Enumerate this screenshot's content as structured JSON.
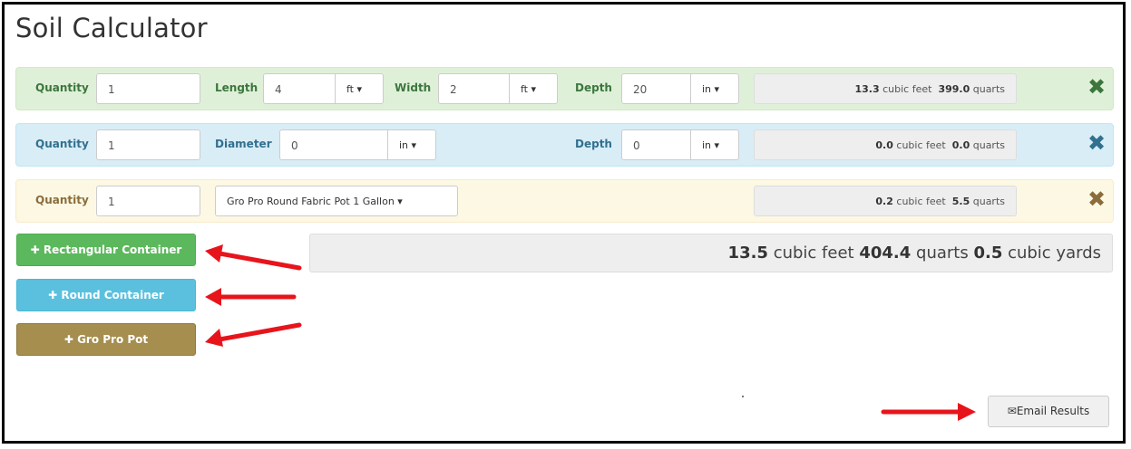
{
  "title": "Soil Calculator",
  "rows": {
    "rect": {
      "quantity_label": "Quantity",
      "quantity_value": "1",
      "length_label": "Length",
      "length_value": "4",
      "length_unit": "ft",
      "width_label": "Width",
      "width_value": "2",
      "width_unit": "ft",
      "depth_label": "Depth",
      "depth_value": "20",
      "depth_unit": "in",
      "result_cubic_feet": "13.3",
      "result_cubic_feet_unit": "cubic feet",
      "result_quarts": "399.0",
      "result_quarts_unit": "quarts"
    },
    "round": {
      "quantity_label": "Quantity",
      "quantity_value": "1",
      "diameter_label": "Diameter",
      "diameter_value": "0",
      "diameter_unit": "in",
      "depth_label": "Depth",
      "depth_value": "0",
      "depth_unit": "in",
      "result_cubic_feet": "0.0",
      "result_cubic_feet_unit": "cubic feet",
      "result_quarts": "0.0",
      "result_quarts_unit": "quarts"
    },
    "gro": {
      "quantity_label": "Quantity",
      "quantity_value": "1",
      "pot_selected": "Gro Pro Round Fabric Pot 1 Gallon",
      "result_cubic_feet": "0.2",
      "result_cubic_feet_unit": "cubic feet",
      "result_quarts": "5.5",
      "result_quarts_unit": "quarts"
    }
  },
  "buttons": {
    "rect": "Rectangular Container",
    "round": "Round Container",
    "gro": "Gro Pro Pot",
    "email": "Email Results"
  },
  "total": {
    "cubic_feet": "13.5",
    "cubic_feet_unit": "cubic feet",
    "quarts": "404.4",
    "quarts_unit": "quarts",
    "cubic_yards": "0.5",
    "cubic_yards_unit": "cubic yards"
  },
  "icons": {
    "remove": "close-icon",
    "add": "plus-icon",
    "email": "envelope-icon",
    "caret": "caret-down-icon"
  },
  "colors": {
    "green": "#5cb85c",
    "blue": "#5bc0de",
    "tan": "#a58e4e",
    "arrow": "#e8141b"
  }
}
